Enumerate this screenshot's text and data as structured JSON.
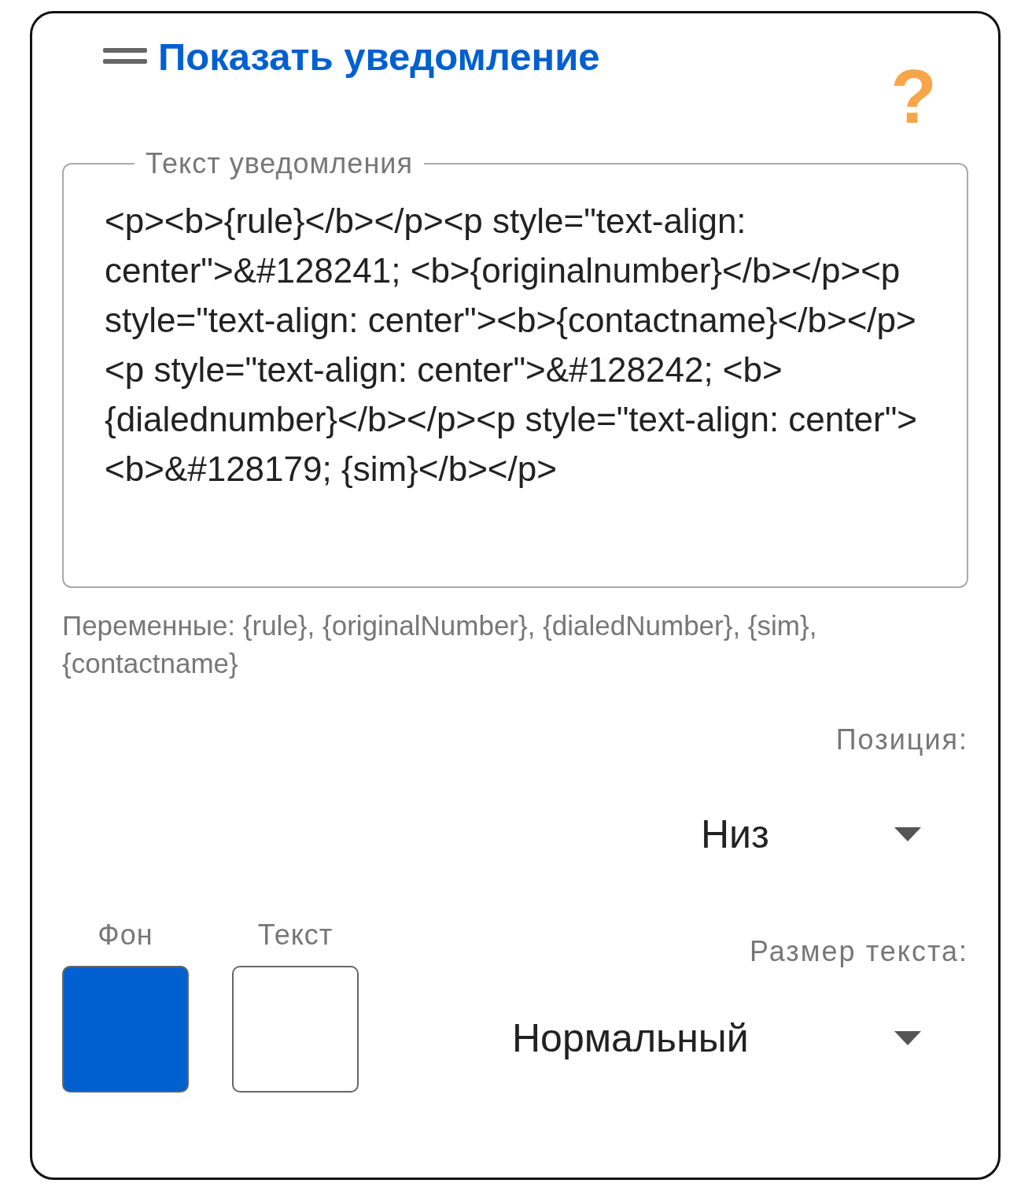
{
  "title": "Показать уведомление",
  "help_icon": "?",
  "message_field": {
    "label": "Текст уведомления",
    "value": "<p><b>{rule}</b></p><p style=\"text-align: center\">&#128241; <b>{originalnumber}</b></p><p style=\"text-align: center\"><b>{contactname}</b></p><p style=\"text-align: center\">&#128242; <b>{dialednumber}</b></p><p style=\"text-align: center\"><b>&#128179; {sim}</b></p>"
  },
  "variables_hint": "Переменные: {rule}, {originalNumber}, {dialedNumber}, {sim}, {contactname}",
  "position": {
    "label": "Позиция:",
    "value": "Низ"
  },
  "swatches": [
    {
      "label": "Фон",
      "color": "#0060d0"
    },
    {
      "label": "Текст",
      "color": "#ffffff"
    }
  ],
  "text_size": {
    "label": "Размер текста:",
    "value": "Нормальный"
  }
}
